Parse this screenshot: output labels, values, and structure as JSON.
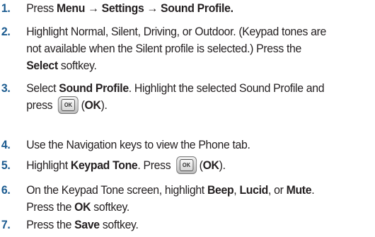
{
  "steps": [
    {
      "number": "1.",
      "lines": [
        [
          {
            "t": "Press ",
            "b": false
          },
          {
            "t": "Menu",
            "b": true
          },
          {
            "t": " → ",
            "b": true
          },
          {
            "t": "Settings",
            "b": true
          },
          {
            "t": " → ",
            "b": true
          },
          {
            "t": "Sound Profile.",
            "b": true
          }
        ]
      ]
    },
    {
      "number": "2.",
      "lines": [
        [
          {
            "t": "Highlight Normal, Silent, Driving, or Outdoor. (Keypad tones are",
            "b": false
          }
        ],
        [
          {
            "t": "not available when the Silent profile is selected.) Press the",
            "b": false
          }
        ],
        [
          {
            "t": "Select",
            "b": true
          },
          {
            "t": " softkey.",
            "b": false
          }
        ]
      ]
    },
    {
      "number": "3.",
      "lines": [
        [
          {
            "t": "Select ",
            "b": false
          },
          {
            "t": "Sound Profile",
            "b": true
          },
          {
            "t": ". Highlight the selected Sound Profile and",
            "b": false
          }
        ],
        [
          {
            "t": "press ",
            "b": false
          },
          {
            "key": "OK"
          },
          {
            "t": "(",
            "b": false
          },
          {
            "t": "OK",
            "b": true
          },
          {
            "t": ").",
            "b": false
          }
        ]
      ]
    },
    {
      "number": "4.",
      "lines": [
        [
          {
            "t": "Use the Navigation keys to view the Phone tab.",
            "b": false
          }
        ]
      ]
    },
    {
      "number": "5.",
      "lines": [
        [
          {
            "t": "Highlight ",
            "b": false
          },
          {
            "t": "Keypad Tone",
            "b": true
          },
          {
            "t": ". Press ",
            "b": false
          },
          {
            "key": "OK"
          },
          {
            "t": "(",
            "b": false
          },
          {
            "t": "OK",
            "b": true
          },
          {
            "t": ").",
            "b": false
          }
        ]
      ]
    },
    {
      "number": "6.",
      "lines": [
        [
          {
            "t": "On the Keypad Tone screen, highlight ",
            "b": false
          },
          {
            "t": "Beep",
            "b": true
          },
          {
            "t": ", ",
            "b": false
          },
          {
            "t": "Lucid",
            "b": true
          },
          {
            "t": ", or ",
            "b": false
          },
          {
            "t": "Mute",
            "b": true
          },
          {
            "t": ".",
            "b": false
          }
        ],
        [
          {
            "t": "Press the ",
            "b": false
          },
          {
            "t": "OK",
            "b": true
          },
          {
            "t": " softkey.",
            "b": false
          }
        ]
      ]
    },
    {
      "number": "7.",
      "lines": [
        [
          {
            "t": "Press the ",
            "b": false
          },
          {
            "t": "Save",
            "b": true
          },
          {
            "t": " softkey.",
            "b": false
          }
        ]
      ]
    }
  ],
  "icons": {
    "ok_key": "ok-key-icon"
  },
  "colors": {
    "step_number": "#1a5a8f",
    "text": "#231f20"
  }
}
